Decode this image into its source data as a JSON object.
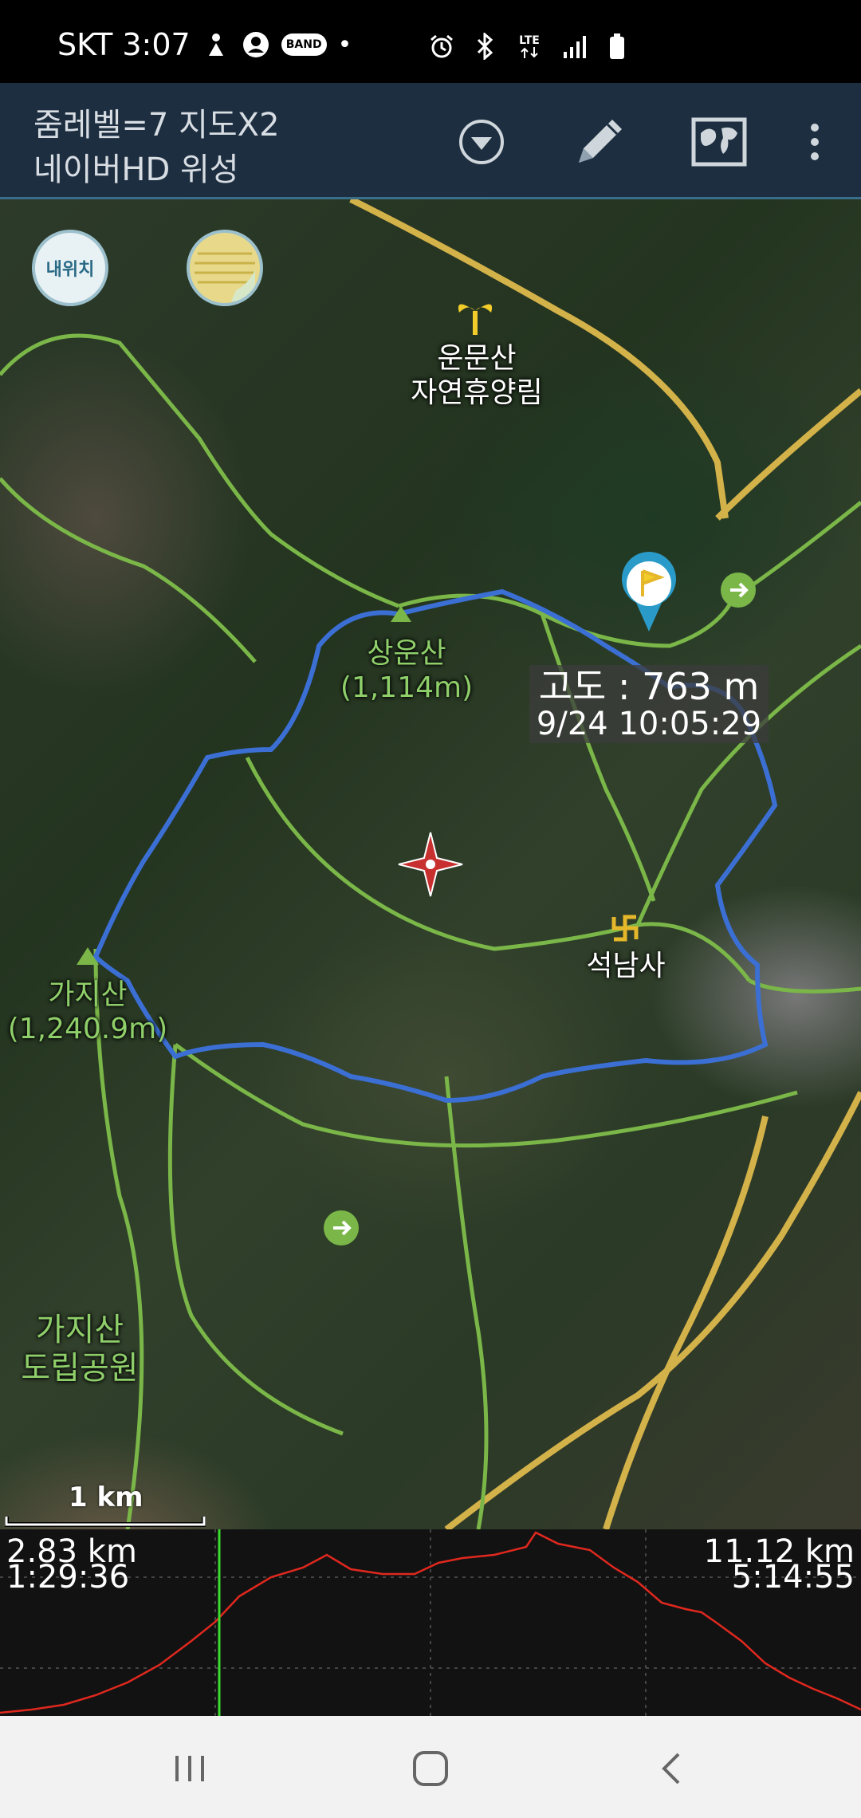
{
  "status_bar": {
    "time_label": "SKT 3:07",
    "band_badge": "BAND",
    "dot": "•",
    "lte_label": "LTE",
    "icons": [
      "notification-icon",
      "account-icon",
      "band-icon",
      "alarm-icon",
      "bluetooth-icon",
      "lte-icon",
      "signal-icon",
      "battery-icon"
    ]
  },
  "app_bar": {
    "line1": "줌레벨=7 지도X2",
    "line2": "네이버HD 위성",
    "actions": [
      "dropdown-icon",
      "pencil-icon",
      "map-layers-icon",
      "more-icon"
    ]
  },
  "map": {
    "my_location_button": "내위치",
    "labels": {
      "forest": "운문산\n자연휴양림",
      "sangunsan": "상운산\n(1,114m)",
      "gajisan": "가지산\n(1,240.9m)",
      "seoknamsa": "석남사",
      "park": "가지산\n도립공원"
    },
    "altitude_popup": {
      "altitude": "고도 : 763 m",
      "timestamp": "9/24 10:05:29"
    },
    "scale_label": "1 km",
    "colors": {
      "track": "#3b6fd4",
      "trail": "#7ab648",
      "road": "#d4b24a"
    }
  },
  "profile": {
    "left_distance": "2.83 km",
    "left_time": "1:29:36",
    "right_distance": "11.12 km",
    "right_time": "5:14:55",
    "cursor_color": "#3bdc2f",
    "line_color": "#e0281e"
  },
  "nav_bar": {
    "items": [
      "recents-icon",
      "home-icon",
      "back-icon"
    ]
  }
}
